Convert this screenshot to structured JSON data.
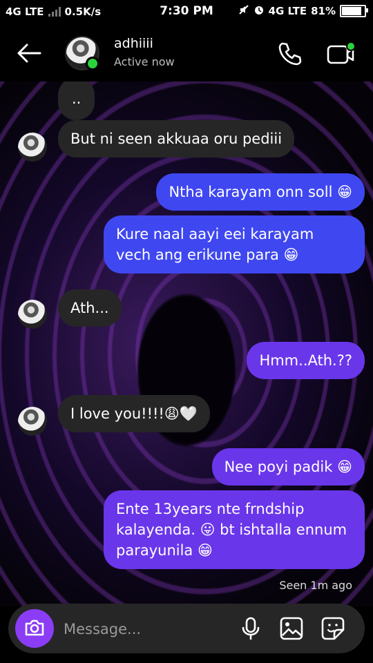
{
  "status_bar": {
    "network_left": "4G LTE",
    "speed": "0.5K/s",
    "time": "7:30 PM",
    "network_right": "4G LTE",
    "battery_text": "81%",
    "battery_level": 0.81
  },
  "header": {
    "contact_name": "adhiiii",
    "status": "Active now"
  },
  "messages": [
    {
      "from": "them",
      "text": ".."
    },
    {
      "from": "them",
      "text": "But ni seen akkuaa oru pediii"
    },
    {
      "from": "me",
      "text": "Ntha karayam onn soll 😁"
    },
    {
      "from": "me",
      "text": "Kure naal aayi eei karayam vech ang erikune para 😁"
    },
    {
      "from": "them",
      "text": "Ath..."
    },
    {
      "from": "me",
      "text": "Hmm..Ath.??"
    },
    {
      "from": "them",
      "text": "I love you!!!!😩🤍"
    },
    {
      "from": "me",
      "text": "Nee poyi padik 😁"
    },
    {
      "from": "me",
      "text": "Ente 13years nte frndship kalayenda. 😛 bt ishtalla ennum parayunila 😁"
    }
  ],
  "seen_text": "Seen 1m ago",
  "composer": {
    "placeholder": "Message..."
  },
  "colors": {
    "sent_blue": "#3f47f0",
    "sent_purple": "#6a36ea",
    "received": "#262626",
    "online": "#2bd33b"
  }
}
